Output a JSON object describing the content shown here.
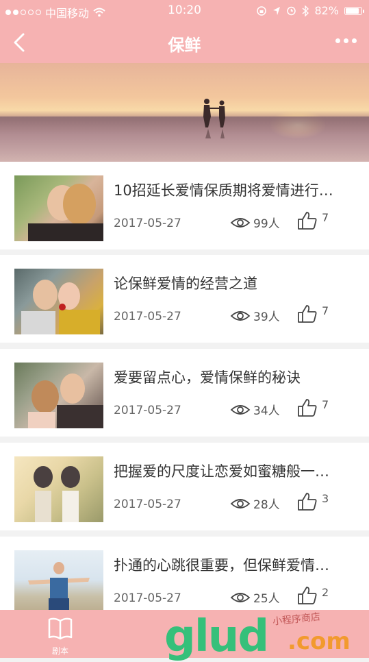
{
  "status": {
    "carrier": "中国移动",
    "time": "10:20",
    "battery": "82%"
  },
  "nav": {
    "title": "保鲜"
  },
  "articles": [
    {
      "title": "10招延长爱情保质期将爱情进行…",
      "date": "2017-05-27",
      "views": "99人",
      "likes": "7"
    },
    {
      "title": "论保鲜爱情的经营之道",
      "date": "2017-05-27",
      "views": "39人",
      "likes": "7"
    },
    {
      "title": "爱要留点心，爱情保鲜的秘诀",
      "date": "2017-05-27",
      "views": "34人",
      "likes": "7"
    },
    {
      "title": "把握爱的尺度让恋爱如蜜糖般一…",
      "date": "2017-05-27",
      "views": "28人",
      "likes": "3"
    },
    {
      "title": "扑通的心跳很重要，但保鲜爱情…",
      "date": "2017-05-27",
      "views": "25人",
      "likes": "2"
    }
  ],
  "tabbar": {
    "tab1_label": "剧本"
  },
  "watermark": {
    "logo": "glud",
    "domain": ".com",
    "text": "小程序商店"
  },
  "colors": {
    "accent": "#f6b2b2"
  }
}
